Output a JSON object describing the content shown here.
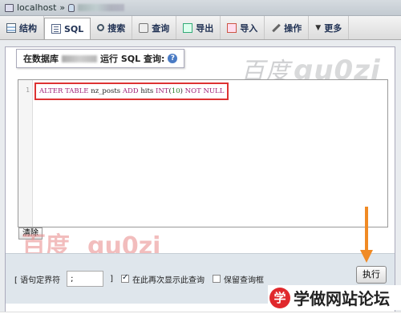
{
  "breadcrumb": {
    "server": "localhost",
    "separator": "»"
  },
  "tabs": [
    {
      "label": "结构",
      "icon": "structure-icon"
    },
    {
      "label": "SQL",
      "icon": "sql-icon",
      "active": true
    },
    {
      "label": "搜索",
      "icon": "search-icon"
    },
    {
      "label": "查询",
      "icon": "query-icon"
    },
    {
      "label": "导出",
      "icon": "export-icon"
    },
    {
      "label": "导入",
      "icon": "import-icon"
    },
    {
      "label": "操作",
      "icon": "wrench-icon"
    },
    {
      "label": "更多",
      "icon": "chevron-down-icon"
    }
  ],
  "panel": {
    "legend_prefix": "在数据库",
    "legend_suffix": "运行 SQL 查询:"
  },
  "editor": {
    "line_number": "1",
    "sql": {
      "alter": "ALTER",
      "table": "TABLE",
      "table_name": "nz_posts",
      "add": "ADD",
      "column": "hits",
      "type": "INT",
      "length_open": "(",
      "length": "10",
      "length_close": ")",
      "not": "NOT",
      "null": "NULL"
    }
  },
  "buttons": {
    "clear": "清除",
    "go": "执行"
  },
  "options": {
    "delimiter_label_open": "[ 语句定界符",
    "delimiter_value": ";",
    "delimiter_label_close": "]",
    "show_again_label": "在此再次显示此查询",
    "show_again_checked": true,
    "retain_box_label": "保留查询框",
    "retain_box_checked": false
  },
  "watermarks": {
    "top_script": "百度",
    "top_brand": "gu0zi",
    "bottom_cn": "百度",
    "bottom_brand": "gu0zi",
    "site_logo": "学",
    "site_name": "学做网站论坛"
  },
  "colors": {
    "highlight_border": "#dd3333",
    "arrow": "#f08a24",
    "sql_keyword": "#a0247a",
    "sql_number": "#2a7e2a"
  }
}
